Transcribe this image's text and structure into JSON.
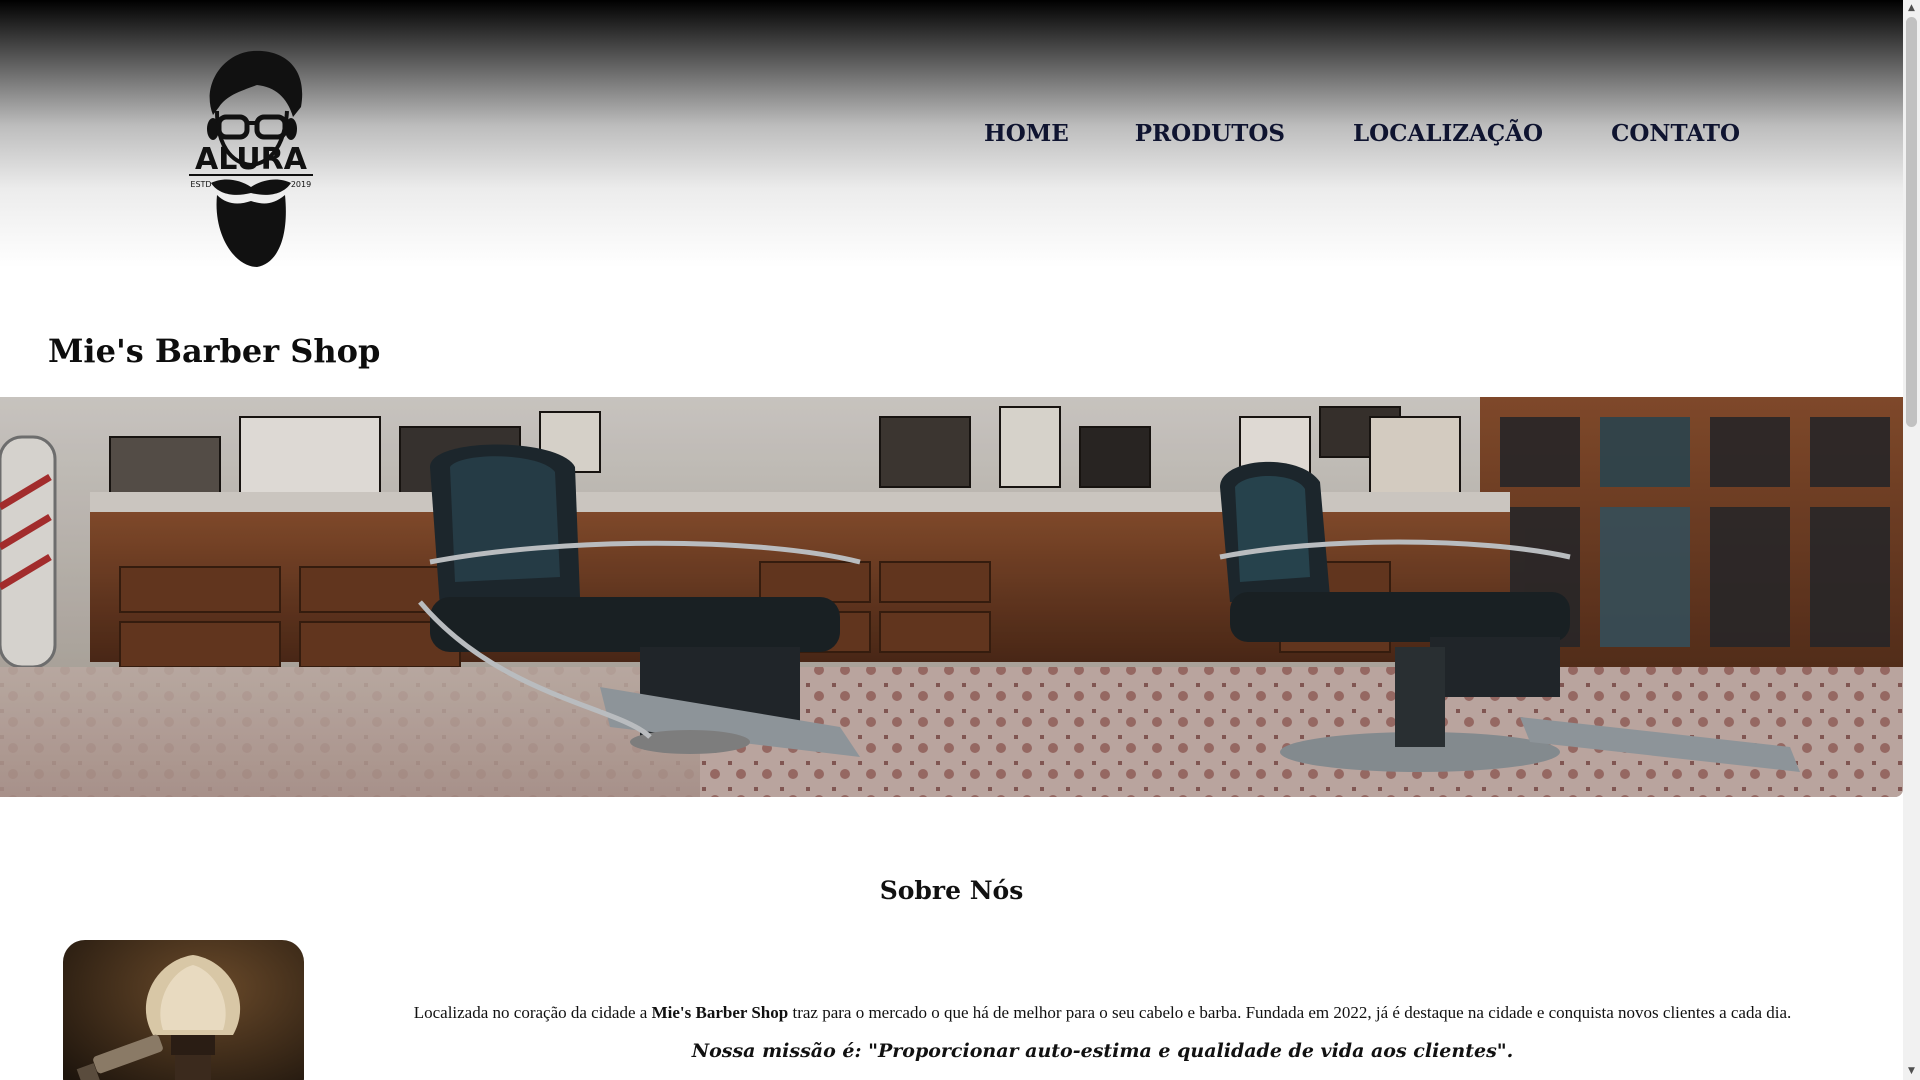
{
  "brand": {
    "logo_text": "ALURA",
    "logo_estd": "ESTD",
    "logo_year": "2019"
  },
  "nav": {
    "items": [
      {
        "label": "HOME"
      },
      {
        "label": "PRODUTOS"
      },
      {
        "label": "LOCALIZAÇÃO"
      },
      {
        "label": "CONTATO"
      }
    ]
  },
  "page": {
    "title": "Mie's Barber Shop"
  },
  "about": {
    "heading": "Sobre Nós",
    "text_before": "Localizada no coração da cidade a ",
    "shop_name": "Mie's Barber Shop",
    "text_after": " traz para o mercado o que há de melhor para o seu cabelo e barba. Fundada em 2022, já é destaque na cidade e conquista novos clientes a cada dia.",
    "mission": "Nossa missão é: \"Proporcionar auto-estima e qualidade de vida aos clientes\"."
  },
  "icons": {
    "scroll_up": "scroll-up-arrow-icon",
    "scroll_down": "scroll-down-arrow-icon"
  },
  "colors": {
    "nav_text": "#0f1430",
    "header_top": "#000000",
    "header_bottom": "#ffffff"
  }
}
